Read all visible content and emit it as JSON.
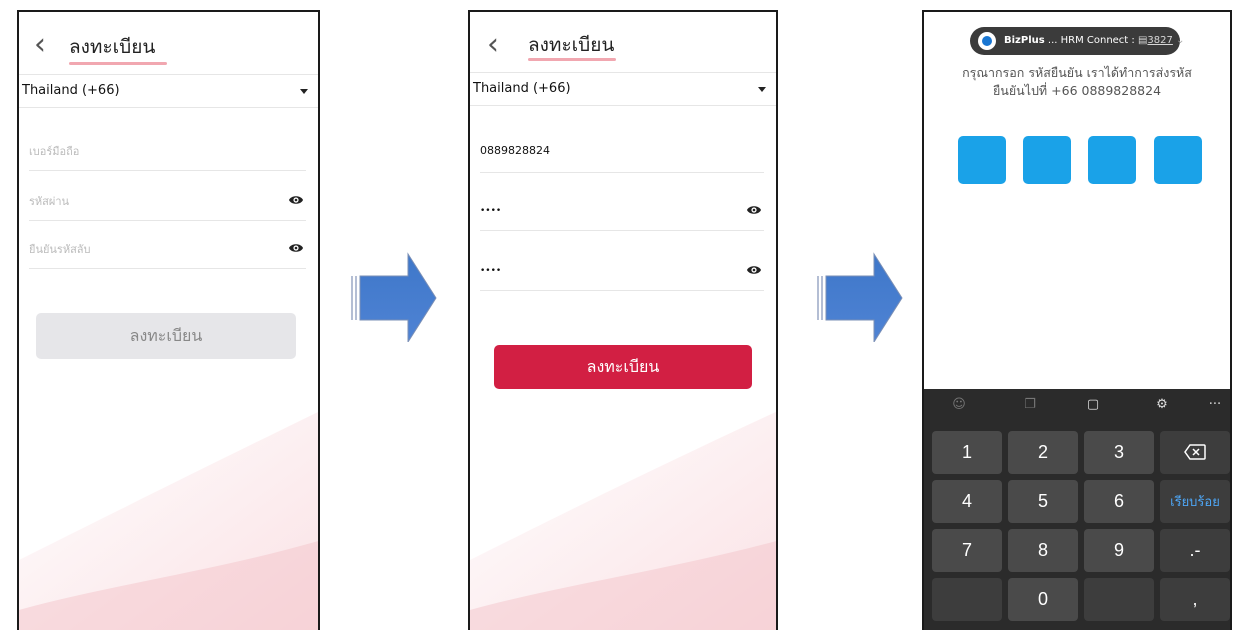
{
  "screen1": {
    "title": "ลงทะเบียน",
    "back_icon": "chevron-left-icon",
    "country": "Thailand (+66)",
    "phone_placeholder": "เบอร์มือถือ",
    "password_placeholder": "รหัสผ่าน",
    "confirm_placeholder": "ยืนยันรหัสลับ",
    "register_button": "ลงทะเบียน"
  },
  "screen2": {
    "title": "ลงทะเบียน",
    "country": "Thailand (+66)",
    "phone_value": "0889828824",
    "password_value": "••••",
    "confirm_value": "••••",
    "register_button": "ลงทะเบียน",
    "button_color": "#d21f43"
  },
  "screen3": {
    "notification": {
      "app": "BizPlus",
      "text": "... HRM Connect :",
      "code": "3827"
    },
    "instruction_line1": "กรุณากรอก รหัสยืนยัน เราได้ทำการส่งรหัส",
    "instruction_line2": "ยืนยันไปที่ +66 0889828824",
    "otp_color": "#1aa2e8",
    "keyboard": {
      "tools": [
        "emoji-icon",
        "sticker-icon",
        "clipboard-icon",
        "settings-icon",
        "more-icon"
      ],
      "more_label": "···",
      "rows": [
        [
          "1",
          "2",
          "3",
          "⌫"
        ],
        [
          "4",
          "5",
          "6",
          "เรียบร้อย"
        ],
        [
          "7",
          "8",
          "9",
          ".-"
        ],
        [
          "",
          "0",
          "",
          ","
        ]
      ]
    }
  }
}
